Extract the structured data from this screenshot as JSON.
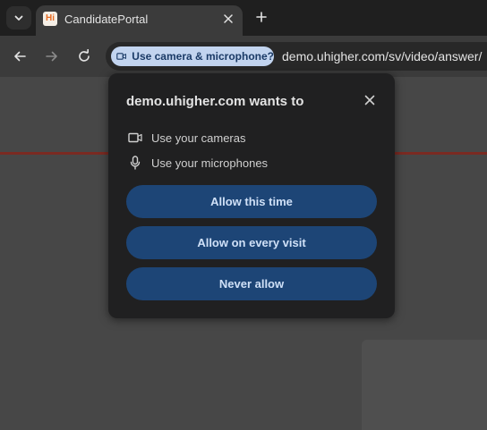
{
  "browser": {
    "tab": {
      "favicon_text": "Hi",
      "title": "CandidatePortal"
    },
    "omnibox": {
      "permission_chip": "Use camera & microphone?",
      "url": "demo.uhigher.com/sv/video/answer/"
    }
  },
  "dialog": {
    "title": "demo.uhigher.com wants to",
    "permissions": [
      {
        "icon": "camera-icon",
        "label": "Use your cameras"
      },
      {
        "icon": "microphone-icon",
        "label": "Use your microphones"
      }
    ],
    "buttons": {
      "allow_once": "Allow this time",
      "allow_always": "Allow on every visit",
      "never": "Never allow"
    }
  },
  "colors": {
    "chip_bg": "#c2d4ef",
    "button_bg": "#1d4576",
    "dialog_bg": "#202021",
    "accent_line": "#7a2a22"
  }
}
